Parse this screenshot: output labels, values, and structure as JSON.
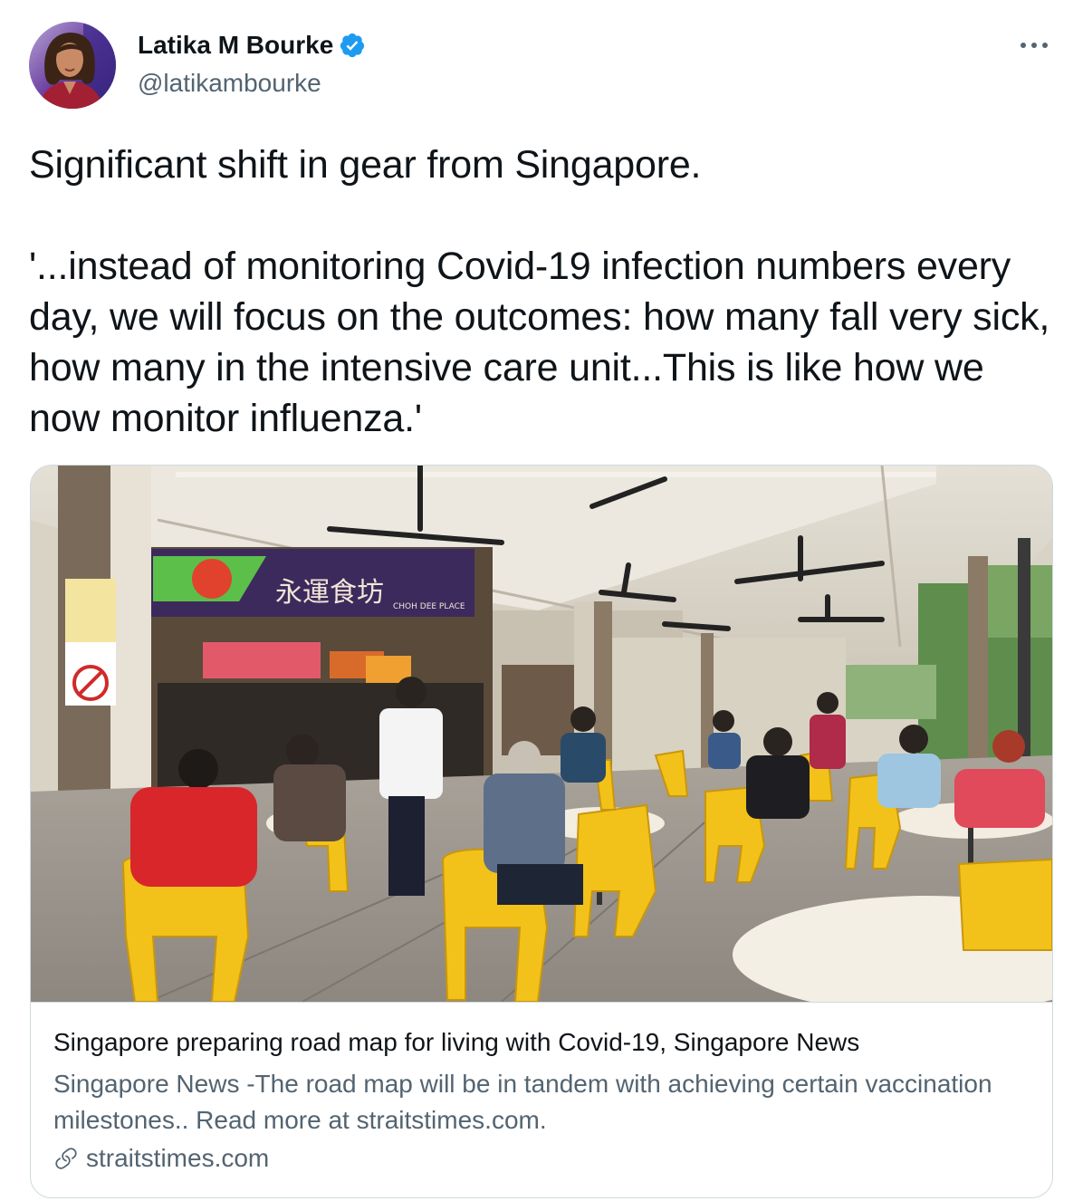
{
  "author": {
    "name": "Latika M Bourke",
    "handle": "@latikambourke",
    "verified": true
  },
  "tweet": {
    "line1": "Significant shift in gear from Singapore.",
    "quote": "'...instead of monitoring Covid-19 infection numbers every day, we will focus on the outcomes: how many fall very sick, how many in the intensive care unit...This is like how we now monitor influenza.'"
  },
  "card": {
    "image_sign": {
      "stall_chinese": "永運食坊",
      "stall_english": "CHOH DEE PLACE"
    },
    "title": "Singapore preparing road map for living with Covid-19, Singapore News",
    "description": "Singapore News -The road map will be in tandem with achieving certain vaccination milestones.. Read more at straitstimes.com.",
    "domain": "straitstimes.com"
  },
  "icons": {
    "verified": "verified-badge-icon",
    "more": "more-options-icon",
    "link": "link-icon"
  },
  "colors": {
    "verified_blue": "#1d9bf0",
    "text": "#0f1419",
    "secondary": "#536471",
    "border": "#cfd9de"
  }
}
